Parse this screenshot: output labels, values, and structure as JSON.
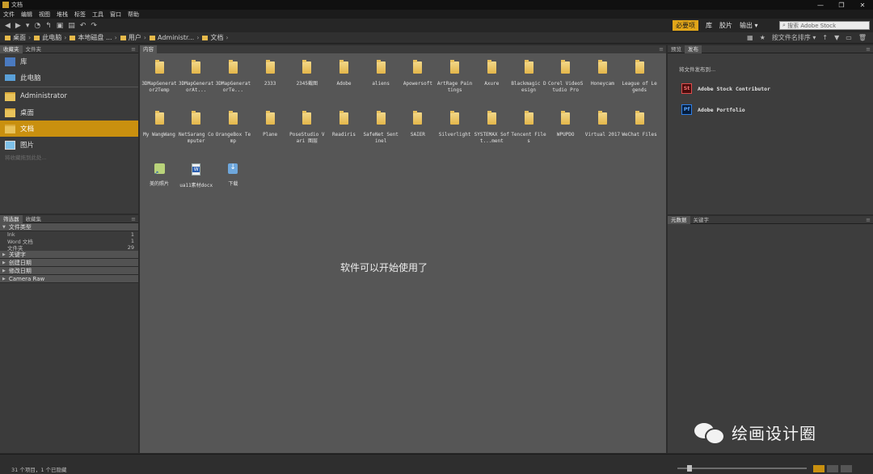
{
  "window": {
    "title": "文档",
    "controls": [
      "—",
      "❐",
      "✕"
    ]
  },
  "menu": [
    "文件",
    "编辑",
    "视图",
    "堆栈",
    "标签",
    "工具",
    "窗口",
    "帮助"
  ],
  "workspaces": [
    "必要项",
    "库",
    "胶片",
    "输出 ▾"
  ],
  "search": {
    "placeholder": "搜索 Adobe Stock"
  },
  "breadcrumb": [
    "桌面",
    "此电脑",
    "本地磁盘 ...",
    "用户",
    "Administr...",
    "文档"
  ],
  "toolbar_right": {
    "sort": "按文件名排序 ▾"
  },
  "favorites_tabs": [
    "收藏夹",
    "文件夹"
  ],
  "favorites": [
    {
      "label": "库",
      "icon": "library-icon"
    },
    {
      "label": "此电脑",
      "icon": "computer-icon"
    },
    {
      "label": "Administrator",
      "icon": "folder-icon"
    },
    {
      "label": "桌面",
      "icon": "folder-icon"
    },
    {
      "label": "文档",
      "icon": "folder-icon"
    },
    {
      "label": "图片",
      "icon": "picture-icon"
    }
  ],
  "favorites_hint": "将收藏拖到此处...",
  "filter_tabs": [
    "筛选器",
    "收藏集"
  ],
  "filters": {
    "file_type": "文件类型",
    "types": [
      {
        "name": "lnk",
        "count": "1"
      },
      {
        "name": "Word 文档",
        "count": "1"
      },
      {
        "name": "文件夹",
        "count": "29"
      }
    ],
    "keywords": "关键字",
    "created": "创建日期",
    "modified": "修改日期",
    "camera_raw": "Camera Raw"
  },
  "content_tab": "内容",
  "files": [
    "3DMapGenerator2Temp",
    "3DMapGeneratorAt...",
    "3DMapGeneratorTe...",
    "2333",
    "2345截图",
    "Adobe",
    "aliens",
    "Apowersoft",
    "ArtRage Paintings",
    "Axure",
    "Blackmagic Design",
    "Corel VideoStudio Pro",
    "Honeycam",
    "League of Legends",
    "My WangWang",
    "NetSarang Computer",
    "OrangeBox Temp",
    "Plane",
    "PoseStudio Vari 图层",
    "Readiris",
    "SafeNet Sentinel",
    "SAIER",
    "Silverlight",
    "SYSTEMAX Soft...ment",
    "Tencent Files",
    "WPUPDO",
    "Virtual 2017",
    "WeChat Files",
    "美的照片",
    "ua11素材docx",
    "下载"
  ],
  "ready_message": "软件可以开始使用了",
  "preview_tabs": [
    "预览",
    "发布"
  ],
  "publish": {
    "hint": "将文件发布到...",
    "services": [
      {
        "badge": "St",
        "label": "Adobe Stock Contributor"
      },
      {
        "badge": "Pf",
        "label": "Adobe Portfolio"
      }
    ]
  },
  "metadata_tabs": [
    "元数据",
    "关键字"
  ],
  "status": "31 个项目，1 个已隐藏",
  "watermark": "绘画设计圈",
  "colors": {
    "accent": "#c9900f",
    "content_bg": "#565656",
    "panel_bg": "#3b3b3b"
  }
}
